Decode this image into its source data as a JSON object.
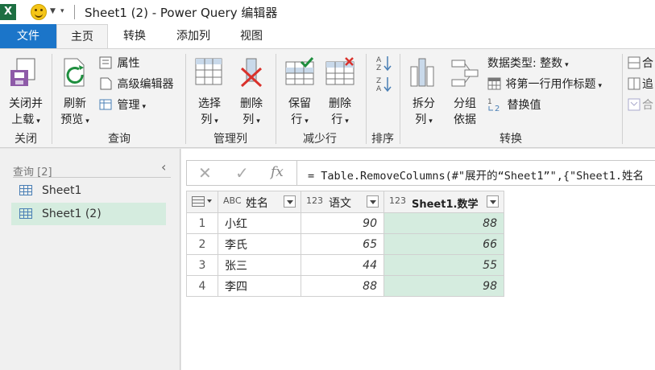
{
  "window": {
    "title": "Sheet1 (2) - Power Query 编辑器",
    "app_logo": "X"
  },
  "tabs": [
    {
      "label": "文件"
    },
    {
      "label": "主页"
    },
    {
      "label": "转换"
    },
    {
      "label": "添加列"
    },
    {
      "label": "视图"
    }
  ],
  "ribbon": {
    "close": {
      "btn1": "关闭并",
      "btn1b": "上载",
      "group": "关闭"
    },
    "query": {
      "refresh": "刷新",
      "refreshb": "预览",
      "properties": "属性",
      "advanced_editor": "高级编辑器",
      "manage": "管理",
      "group": "查询"
    },
    "manage_cols": {
      "choose": "选择",
      "chooseb": "列",
      "remove": "删除",
      "removeb": "列",
      "group": "管理列"
    },
    "reduce_rows": {
      "keep": "保留",
      "keepb": "行",
      "remove": "删除",
      "removeb": "行",
      "group": "减少行"
    },
    "sort": {
      "group": "排序"
    },
    "transform": {
      "split": "拆分",
      "splitb": "列",
      "groupby": "分组",
      "groupbyb": "依据",
      "datatype": "数据类型: 整数",
      "first_row": "将第一行用作标题",
      "replace": "替换值",
      "group": "转换"
    },
    "combine": {
      "item1": "合",
      "item2": "追",
      "item3": "合"
    }
  },
  "queries": {
    "header": "查询 [2]",
    "items": [
      {
        "label": "Sheet1",
        "selected": false
      },
      {
        "label": "Sheet1 (2)",
        "selected": true
      }
    ]
  },
  "formula_bar": {
    "cancel": "✕",
    "commit": "✓",
    "fx": "fx",
    "formula": "= Table.RemoveColumns(#\"展开的“Sheet1”\",{\"Sheet1.姓名"
  },
  "grid": {
    "columns": [
      {
        "name": "姓名",
        "type": "ABC"
      },
      {
        "name": "语文",
        "type": "123"
      },
      {
        "name": "Sheet1.数学",
        "type": "123"
      }
    ],
    "rows": [
      {
        "n": "1",
        "name": "小红",
        "chinese": "90",
        "math": "88"
      },
      {
        "n": "2",
        "name": "李氏",
        "chinese": "65",
        "math": "66"
      },
      {
        "n": "3",
        "name": "张三",
        "chinese": "44",
        "math": "55"
      },
      {
        "n": "4",
        "name": "李四",
        "chinese": "88",
        "math": "98"
      }
    ]
  },
  "colors": {
    "accent": "#1b75c9",
    "selection": "#d5ecdf",
    "excel_green": "#1d6f42"
  }
}
